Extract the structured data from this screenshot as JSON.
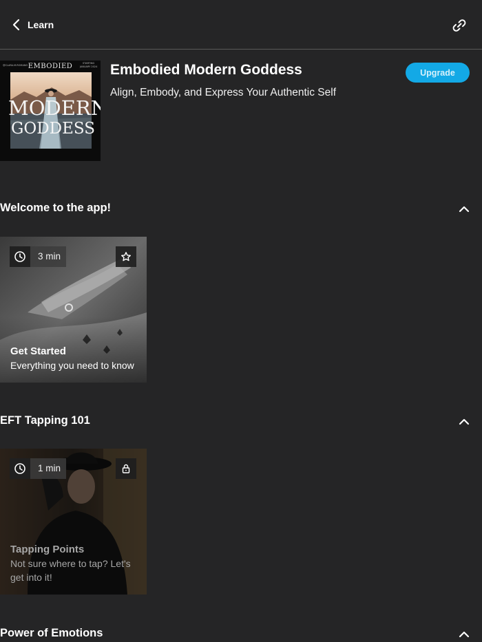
{
  "header": {
    "back_label": "Learn",
    "back_icon": "chevron-left-icon",
    "share_icon": "link-icon"
  },
  "program": {
    "title": "Embodied Modern Goddess",
    "subtitle": "Align, Embody, and Express Your Authentic Self",
    "upgrade_label": "Upgrade",
    "accent_color": "#13a9e6",
    "cover": {
      "brand": "EMBODIED",
      "word1": "MODERN",
      "word2": "GODDESS",
      "small_left": "@CLARA.M.ROMANO",
      "small_right_1": "STARTING",
      "small_right_2": "JANUARY 2024"
    }
  },
  "sections": [
    {
      "title": "Welcome to the app!",
      "expanded": true,
      "items": [
        {
          "duration": "3 min",
          "title": "Get Started",
          "description": "Everything you need to know",
          "corner_icon": "star-icon",
          "locked": false
        }
      ]
    },
    {
      "title": "EFT Tapping 101",
      "expanded": true,
      "items": [
        {
          "duration": "1 min",
          "title": "Tapping Points",
          "description": "Not sure where to tap? Let's get into it!",
          "corner_icon": "lock-icon",
          "locked": true
        }
      ]
    },
    {
      "title": "Power of Emotions",
      "expanded": true,
      "items": []
    }
  ]
}
